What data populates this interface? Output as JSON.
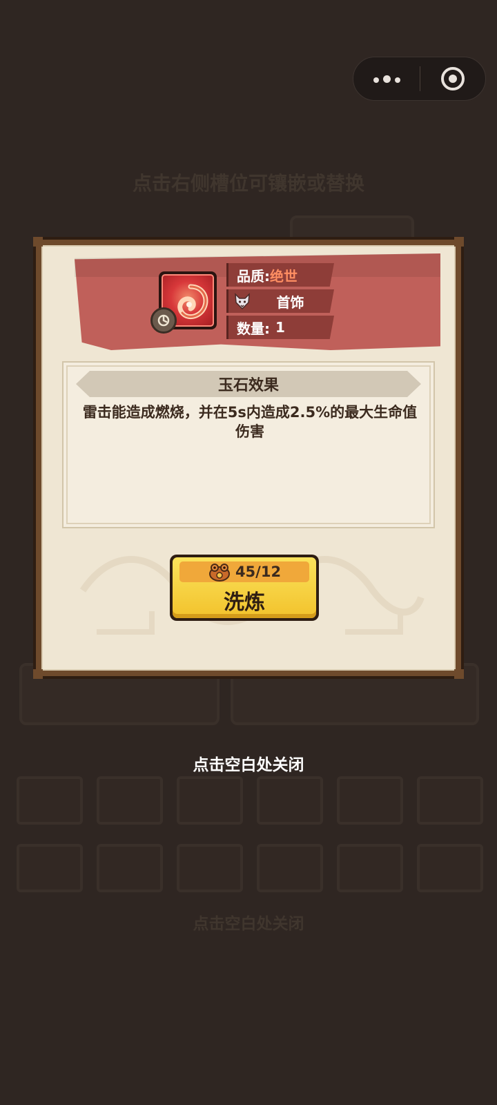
{
  "background": {
    "top_hint": "点击右侧槽位可镶嵌或替换",
    "bottom_hint": "点击空白处关闭"
  },
  "capsule": {
    "more_icon": "more-dots-icon",
    "close_icon": "close-circle-icon"
  },
  "item": {
    "icon": "jade-stone-icon",
    "badge_icon": "sync-badge-icon",
    "quality_label": "品质:",
    "quality_value": "绝世",
    "type_icon": "wolf-head-icon",
    "type_value": "首饰",
    "count_label": "数量:",
    "count_value": "1"
  },
  "effect": {
    "title": "玉石效果",
    "description": "雷击能造成燃烧，并在5s内造成2.5%的最大生命值伤害"
  },
  "refine": {
    "cost_icon": "toad-coin-icon",
    "cost_text": "45/12",
    "label": "洗炼"
  },
  "close_hint": "点击空白处关闭",
  "colors": {
    "banner": "#c0605a",
    "quality_accent": "#ff8e62",
    "button_yellow": "#f2c22c",
    "panel_bg": "#efe6d3"
  }
}
